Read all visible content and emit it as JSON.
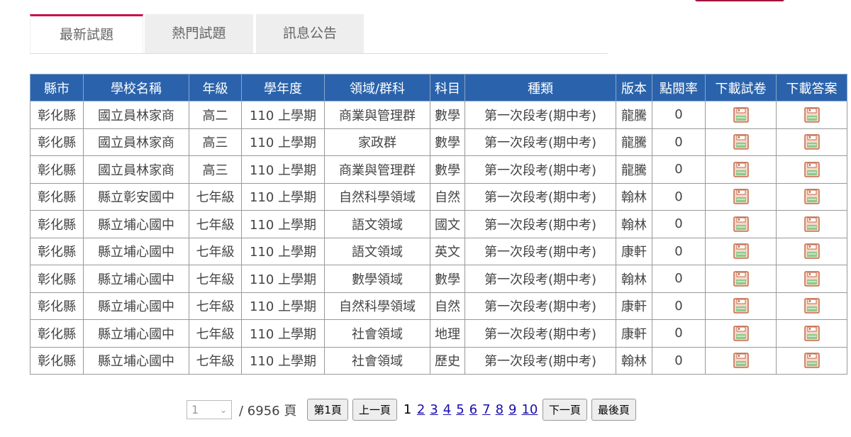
{
  "tabs": [
    {
      "label": "最新試題"
    },
    {
      "label": "熱門試題"
    },
    {
      "label": "訊息公告"
    }
  ],
  "table": {
    "headers": [
      "縣市",
      "學校名稱",
      "年級",
      "學年度",
      "領域/群科",
      "科目",
      "種類",
      "版本",
      "點閱率",
      "下載試卷",
      "下載答案"
    ],
    "rows": [
      [
        "彰化縣",
        "國立員林家商",
        "高二",
        "110 上學期",
        "商業與管理群",
        "數學",
        "第一次段考(期中考)",
        "龍騰",
        "0"
      ],
      [
        "彰化縣",
        "國立員林家商",
        "高三",
        "110 上學期",
        "家政群",
        "數學",
        "第一次段考(期中考)",
        "龍騰",
        "0"
      ],
      [
        "彰化縣",
        "國立員林家商",
        "高三",
        "110 上學期",
        "商業與管理群",
        "數學",
        "第一次段考(期中考)",
        "龍騰",
        "0"
      ],
      [
        "彰化縣",
        "縣立彰安國中",
        "七年級",
        "110 上學期",
        "自然科學領域",
        "自然",
        "第一次段考(期中考)",
        "翰林",
        "0"
      ],
      [
        "彰化縣",
        "縣立埔心國中",
        "七年級",
        "110 上學期",
        "語文領域",
        "國文",
        "第一次段考(期中考)",
        "翰林",
        "0"
      ],
      [
        "彰化縣",
        "縣立埔心國中",
        "七年級",
        "110 上學期",
        "語文領域",
        "英文",
        "第一次段考(期中考)",
        "康軒",
        "0"
      ],
      [
        "彰化縣",
        "縣立埔心國中",
        "七年級",
        "110 上學期",
        "數學領域",
        "數學",
        "第一次段考(期中考)",
        "翰林",
        "0"
      ],
      [
        "彰化縣",
        "縣立埔心國中",
        "七年級",
        "110 上學期",
        "自然科學領域",
        "自然",
        "第一次段考(期中考)",
        "康軒",
        "0"
      ],
      [
        "彰化縣",
        "縣立埔心國中",
        "七年級",
        "110 上學期",
        "社會領域",
        "地理",
        "第一次段考(期中考)",
        "康軒",
        "0"
      ],
      [
        "彰化縣",
        "縣立埔心國中",
        "七年級",
        "110 上學期",
        "社會領域",
        "歷史",
        "第一次段考(期中考)",
        "翰林",
        "0"
      ]
    ]
  },
  "pager": {
    "select_value": "1",
    "total": "/ 6956 頁",
    "first": "第1頁",
    "prev": "上一頁",
    "current": "1",
    "pages": [
      "2",
      "3",
      "4",
      "5",
      "6",
      "7",
      "8",
      "9",
      "10"
    ],
    "next": "下一頁",
    "last": "最後頁"
  },
  "colors": {
    "header": "#2a63ac",
    "tab_accent": "#c8104b"
  }
}
